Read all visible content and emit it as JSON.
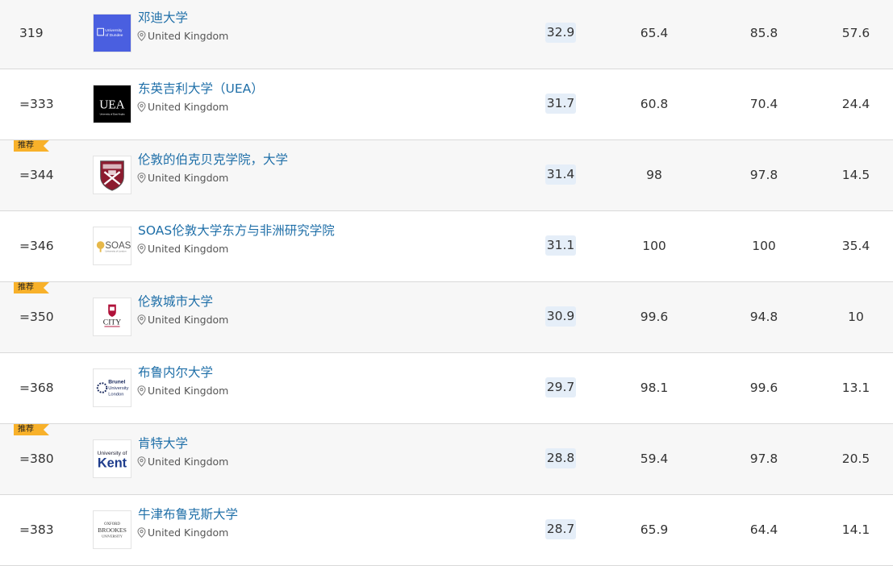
{
  "rows": [
    {
      "rank": "319",
      "name": "邓迪大学",
      "country": "United Kingdom",
      "overall": "32.9",
      "s1": "65.4",
      "s2": "85.8",
      "s3": "57.6",
      "badge": "",
      "logo_text": [
        "University",
        "of Dundee"
      ],
      "logo_color": "#4a5fe0"
    },
    {
      "rank": "=333",
      "name": "东英吉利大学（UEA）",
      "country": "United Kingdom",
      "overall": "31.7",
      "s1": "60.8",
      "s2": "70.4",
      "s3": "24.4",
      "badge": "",
      "logo_text": [
        "UEA",
        "University of East Anglia"
      ],
      "logo_color": "#000000"
    },
    {
      "rank": "=344",
      "name": "伦敦的伯克贝克学院，大学",
      "country": "United Kingdom",
      "overall": "31.4",
      "s1": "98",
      "s2": "97.8",
      "s3": "14.5",
      "badge": "推荐",
      "logo_text": [],
      "logo_color": "#8c1c2f"
    },
    {
      "rank": "=346",
      "name": "SOAS伦敦大学东方与非洲研究学院",
      "country": "United Kingdom",
      "overall": "31.1",
      "s1": "100",
      "s2": "100",
      "s3": "35.4",
      "badge": "",
      "logo_text": [
        "SOAS",
        "University of London"
      ],
      "logo_color": "#e6b84a"
    },
    {
      "rank": "=350",
      "name": "伦敦城市大学",
      "country": "United Kingdom",
      "overall": "30.9",
      "s1": "99.6",
      "s2": "94.8",
      "s3": "10",
      "badge": "推荐",
      "logo_text": [
        "CITY"
      ],
      "logo_color": "#b0123a"
    },
    {
      "rank": "=368",
      "name": "布鲁内尔大学",
      "country": "United Kingdom",
      "overall": "29.7",
      "s1": "98.1",
      "s2": "99.6",
      "s3": "13.1",
      "badge": "",
      "logo_text": [
        "Brunel",
        "University",
        "London"
      ],
      "logo_color": "#1a2a5e"
    },
    {
      "rank": "=380",
      "name": "肯特大学",
      "country": "United Kingdom",
      "overall": "28.8",
      "s1": "59.4",
      "s2": "97.8",
      "s3": "20.5",
      "badge": "推荐",
      "logo_text": [
        "University of",
        "Kent"
      ],
      "logo_color": "#1e3c8c"
    },
    {
      "rank": "=383",
      "name": "牛津布鲁克斯大学",
      "country": "United Kingdom",
      "overall": "28.7",
      "s1": "65.9",
      "s2": "64.4",
      "s3": "14.1",
      "badge": "",
      "logo_text": [
        "OXFORD",
        "BROOKES",
        "UNIVERSITY"
      ],
      "logo_color": "#333333"
    }
  ]
}
